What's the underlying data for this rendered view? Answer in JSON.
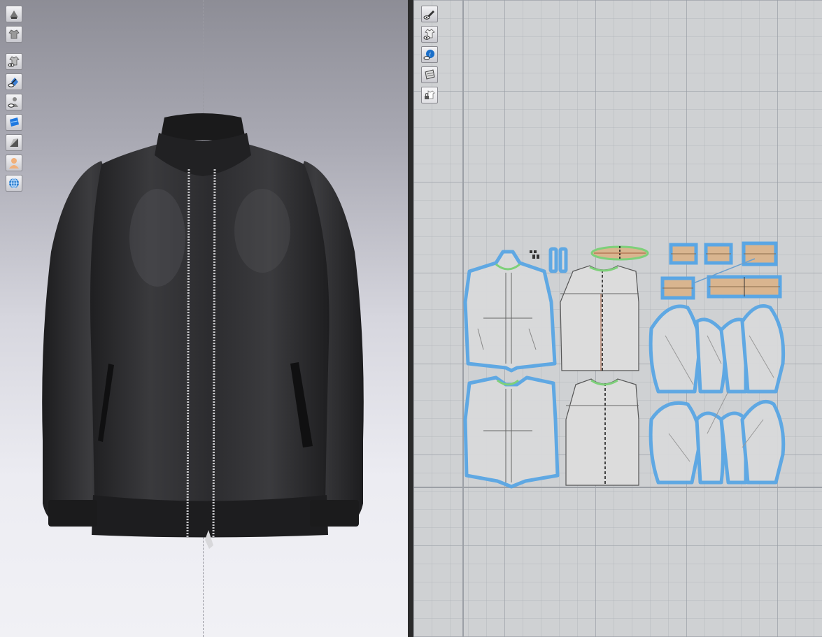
{
  "app": {
    "panels": [
      "3d-garment-window",
      "2d-pattern-window"
    ]
  },
  "toolbar_3d": {
    "tools": [
      {
        "icon": "avatar-display-icon"
      },
      {
        "icon": "garment-display-icon"
      },
      {
        "icon": "show-garment-icon"
      },
      {
        "icon": "show-avatar-icon"
      },
      {
        "icon": "avatar-silhouette-icon"
      },
      {
        "icon": "texture-icon"
      },
      {
        "icon": "shading-icon"
      },
      {
        "icon": "skin-icon"
      },
      {
        "icon": "environment-icon"
      }
    ]
  },
  "toolbar_2d": {
    "tools": [
      {
        "icon": "pattern-edit-icon"
      },
      {
        "icon": "show-garment-2d-icon"
      },
      {
        "icon": "info-icon"
      },
      {
        "icon": "texture-2d-icon"
      },
      {
        "icon": "lock-garment-icon"
      }
    ]
  },
  "colors": {
    "jacket": "#2b2b2d",
    "pattern_outline": "#5aa6e4",
    "pattern_fill": "#d9dadb",
    "trim_fill": "#d9b58f",
    "collar_green": "#7ed07a"
  }
}
